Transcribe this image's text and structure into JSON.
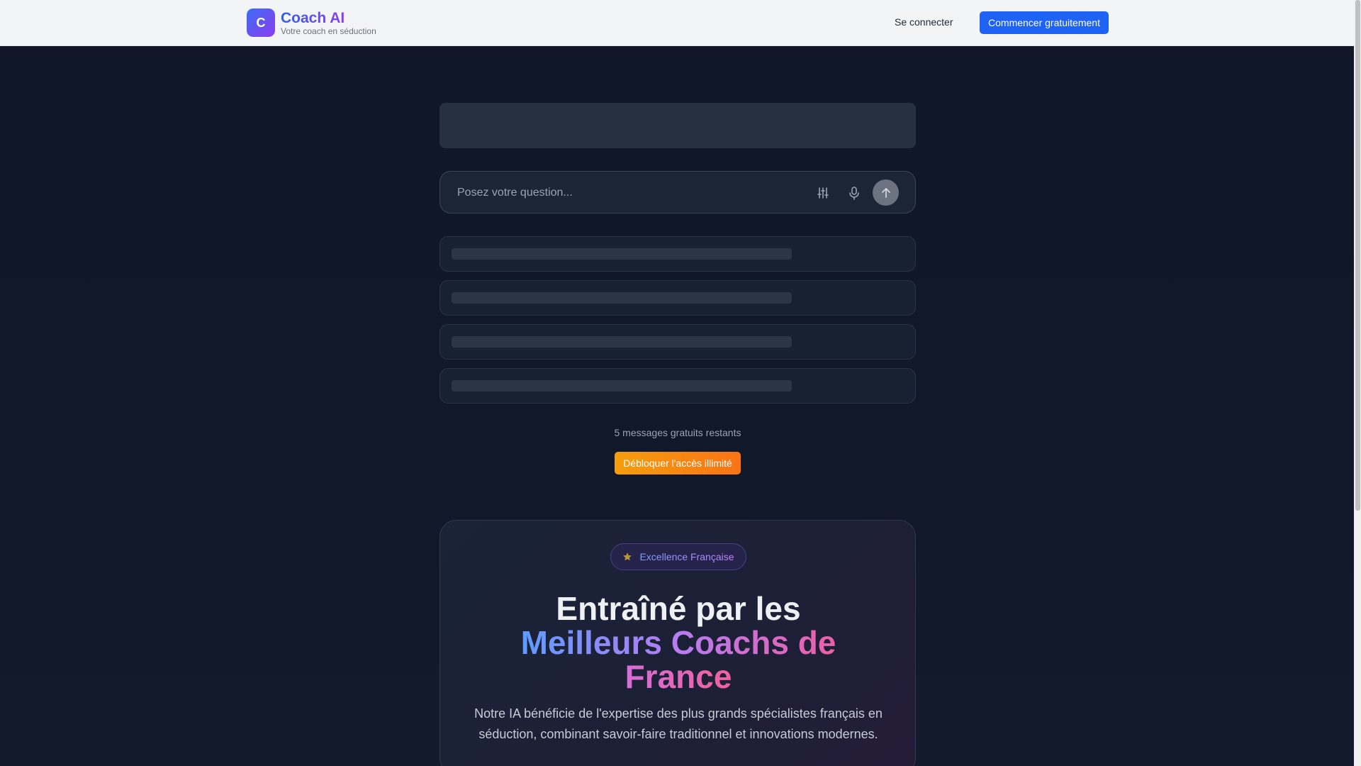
{
  "header": {
    "logo_letter": "C",
    "brand_title": "Coach AI",
    "brand_subtitle": "Votre coach en séduction",
    "login_label": "Se connecter",
    "cta_label": "Commencer gratuitement"
  },
  "chat": {
    "input_placeholder": "Posez votre question...",
    "icons": [
      "settings-sliders-icon",
      "microphone-icon",
      "arrow-up-icon"
    ],
    "skeleton_count": 4,
    "remaining_text": "5 messages gratuits restants",
    "unlock_label": "Débloquer l'accès illimité"
  },
  "feature": {
    "badge_label": "Excellence Française",
    "headline_line1": "Entraîné par les",
    "headline_line2a": "Meilleurs Coachs de",
    "headline_line3": "France",
    "description": "Notre IA bénéficie de l'expertise des plus grands spécialistes français en séduction, combinant savoir-faire traditionnel et innovations modernes."
  },
  "colors": {
    "primary": "#1f63f5",
    "accent_orange": "#f97316",
    "background": "#0f1626"
  }
}
